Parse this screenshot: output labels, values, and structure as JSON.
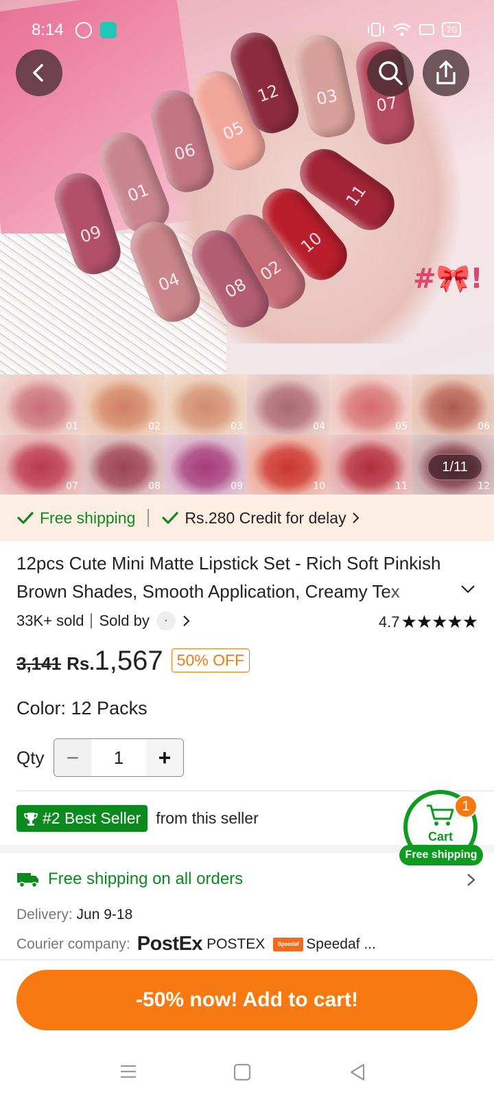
{
  "status_bar": {
    "time": "8:14",
    "battery": "70"
  },
  "hero": {
    "tag": "#🎀!",
    "stick_numbers": [
      "09",
      "01",
      "06",
      "05",
      "12",
      "03",
      "07",
      "11",
      "10",
      "02",
      "08",
      "04"
    ]
  },
  "image_counter": "1/11",
  "swatches": [
    "01",
    "02",
    "03",
    "04",
    "05",
    "06",
    "07",
    "08",
    "09",
    "10",
    "11",
    "12"
  ],
  "shipping_strip": {
    "free_shipping": "Free shipping",
    "credit": "Rs.280 Credit for delay"
  },
  "product": {
    "title": "12pcs Cute Mini Matte Lipstick Set - Rich Soft Pinkish Brown Shades, Smooth Application, Creamy Tex",
    "sold": "33K+ sold",
    "sold_by": "Sold by",
    "rating": "4.7",
    "stars": "★★★★★",
    "price_old": "3,141",
    "currency": "Rs.",
    "price": "1,567",
    "discount": "50% OFF",
    "color_label": "Color: 12 Packs"
  },
  "quantity": {
    "label": "Qty",
    "value": "1",
    "minus": "−",
    "plus": "+"
  },
  "best_seller": {
    "badge": "#2 Best Seller",
    "suffix": "from this seller"
  },
  "cart": {
    "label": "Cart",
    "count": "1",
    "free_shipping": "Free shipping"
  },
  "shipping": {
    "title": "Free shipping on all orders",
    "delivery_label": "Delivery:",
    "delivery_value": "Jun 9-18",
    "courier_label": "Courier company:",
    "postex_logo": "PostEx",
    "postex_name": "POSTEX",
    "speedaf_name": "Speedaf ..."
  },
  "cta": "-50% now! Add to cart!",
  "colors": {
    "green": "#0b8a1f",
    "orange": "#f8790f",
    "strip_bg": "#fdeee3"
  }
}
